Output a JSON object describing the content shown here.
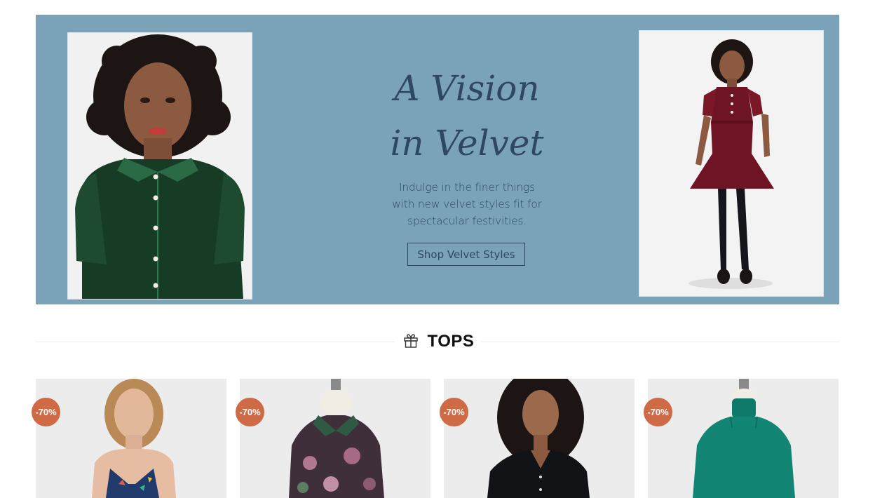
{
  "banner": {
    "headline_line1": "A Vision",
    "headline_line2": "in Velvet",
    "description_line1": "Indulge in the finer things",
    "description_line2": "with new velvet styles fit for",
    "description_line3": "spectacular festivities.",
    "cta_label": "Shop Velvet Styles",
    "background_color": "#7aa3ba",
    "text_color": "#2e4863"
  },
  "section": {
    "title": "TOPS",
    "icon": "gift-icon"
  },
  "products": [
    {
      "discount": "-70%",
      "image": "model-blue-print-tank"
    },
    {
      "discount": "-70%",
      "image": "mannequin-floral-blouse"
    },
    {
      "discount": "-70%",
      "image": "model-black-button-top"
    },
    {
      "discount": "-70%",
      "image": "mannequin-teal-turtleneck"
    }
  ],
  "colors": {
    "badge": "#cf6a47"
  }
}
